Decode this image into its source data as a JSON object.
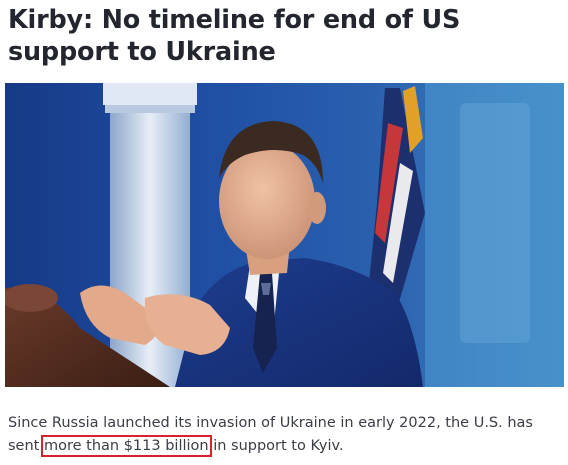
{
  "article": {
    "headline": "Kirby: No timeline for end of US support to Ukraine",
    "photo_alt": "photo-of-speaker-at-podium",
    "caption_before": "Since Russia launched its invasion of Ukraine in early 2022, the U.S. has sent ",
    "caption_highlight": "more than $113 billion",
    "caption_after": " in support to Kyiv."
  },
  "colors": {
    "headline": "#23262e",
    "highlight_box": "#d8232f",
    "backdrop_blue": "#1d3b7a"
  }
}
